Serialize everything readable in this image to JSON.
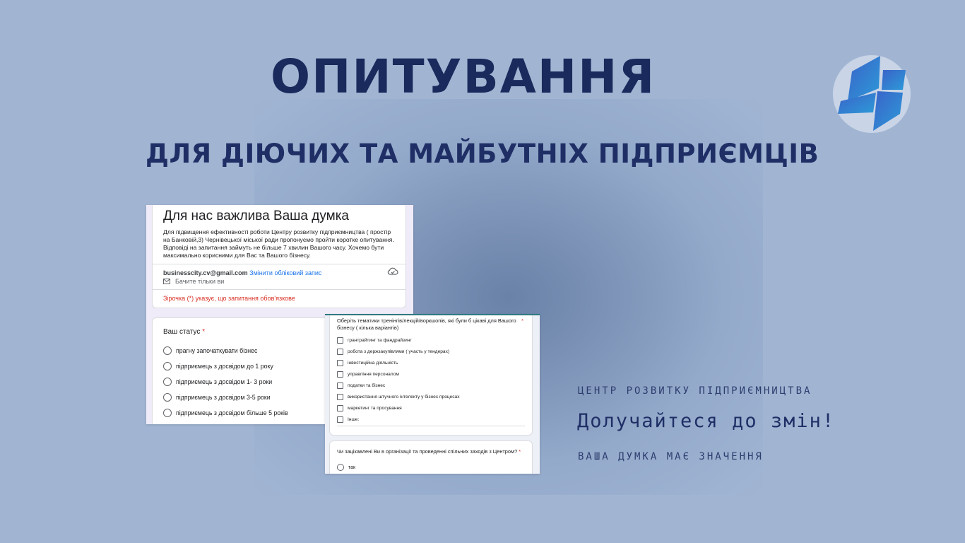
{
  "title": "ОПИТУВАННЯ",
  "subtitle": "ДЛЯ ДІЮЧИХ ТА МАЙБУТНІХ ПІДПРИЄМЦІВ",
  "colors": {
    "background": "#a1b5d3",
    "title": "#1b2a5c",
    "accent_blue": "#1a73e8",
    "required_red": "#d93025"
  },
  "logo_icon": "business-center-logo",
  "form1": {
    "heading": "Для нас важлива Ваша думка",
    "description": "Для підвищення ефективності роботи Центру розвитку підприємництва ( простір на Банковій,3) Чернівецької міської ради пропонуємо пройти коротке опитування. Відповіді на запитання займуть не більше  7 хвилин Вашого часу. Хочемо бути максимально корисними для Вас та Вашого бізнесу.",
    "email": "businesscity.cv@gmail.com",
    "switch_account": "Змінити обліковий запис",
    "only_you": "Бачите тільки ви",
    "required_note": "Зірочка (*) указує, що запитання обов'язкове",
    "question": "Ваш статус",
    "required_star": "*",
    "options": [
      "прагну започаткувати бізнес",
      "підприємець з досвідом до 1 року",
      "підприємець з досвідом 1- 3 роки",
      "підприємець з досвідом 3-5 роки",
      "підприємець з досвідом більше 5 років"
    ]
  },
  "form2": {
    "question": "Оберіть тематики тренінгів/лекцій/воркшопів, які були б цікаві для Вашого бізнесу ( кілька варіантів)",
    "required_star": "*",
    "options": [
      "грантрайтинг та фандрайзинг",
      "робота з держзакупівлями ( участь у тендерах)",
      "інвестиційна діяльність",
      "управління персоналом",
      "податки та бізнес",
      "використання штучного інтелекту у бізнес процесах",
      "маркетинг та просування",
      "Інше:"
    ],
    "question2": "Чи зацікавлені Ви в організації та проведенні спільних заходів з Центром?",
    "question2_star": "*",
    "question2_option": "так"
  },
  "center_name": "ЦЕНТР РОЗВИТКУ ПІДПРИЄМНИЦТВА",
  "call_to_action": "Долучайтеся до змін!",
  "tagline": "ВАША ДУМКА МАЄ ЗНАЧЕННЯ"
}
